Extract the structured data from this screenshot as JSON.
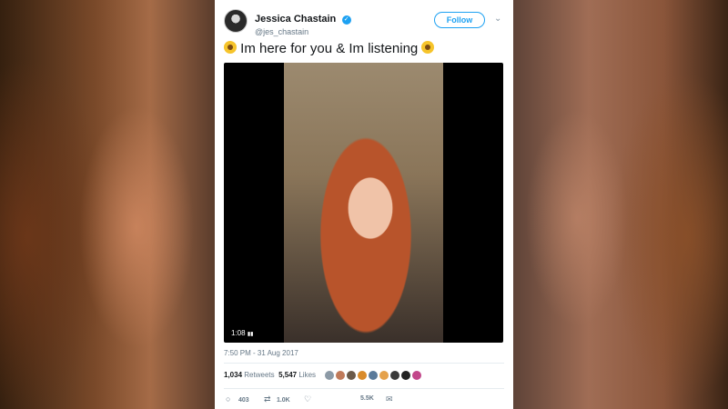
{
  "tweet": {
    "display_name": "Jessica Chastain",
    "handle": "@jes_chastain",
    "follow_label": "Follow",
    "text": "Im here for you & Im listening",
    "video_duration": "1:08",
    "timestamp": "7:50 PM - 31 Aug 2017",
    "retweets_count": "1,034",
    "retweets_label": "Retweets",
    "likes_count": "5,547",
    "likes_label": "Likes",
    "reply_count": "403",
    "retweet_action_count": "1.0K",
    "like_action_count": "5.5K"
  },
  "likers": [
    {
      "color": "#8c9aa6"
    },
    {
      "color": "#c07a5a"
    },
    {
      "color": "#6b5a4a"
    },
    {
      "color": "#d98b2a"
    },
    {
      "color": "#5a7a9a"
    },
    {
      "color": "#e5a14a"
    },
    {
      "color": "#3a3a3a"
    },
    {
      "color": "#222222"
    },
    {
      "color": "#c2478a"
    }
  ],
  "colors": {
    "accent": "#1da1f2",
    "text": "#14171a",
    "secondary": "#657786"
  },
  "icons": {
    "verified": "check-badge",
    "chevron": "chevron-down",
    "reply": "speech-bubble",
    "retweet": "retweet-arrows",
    "like": "heart",
    "message": "envelope"
  }
}
